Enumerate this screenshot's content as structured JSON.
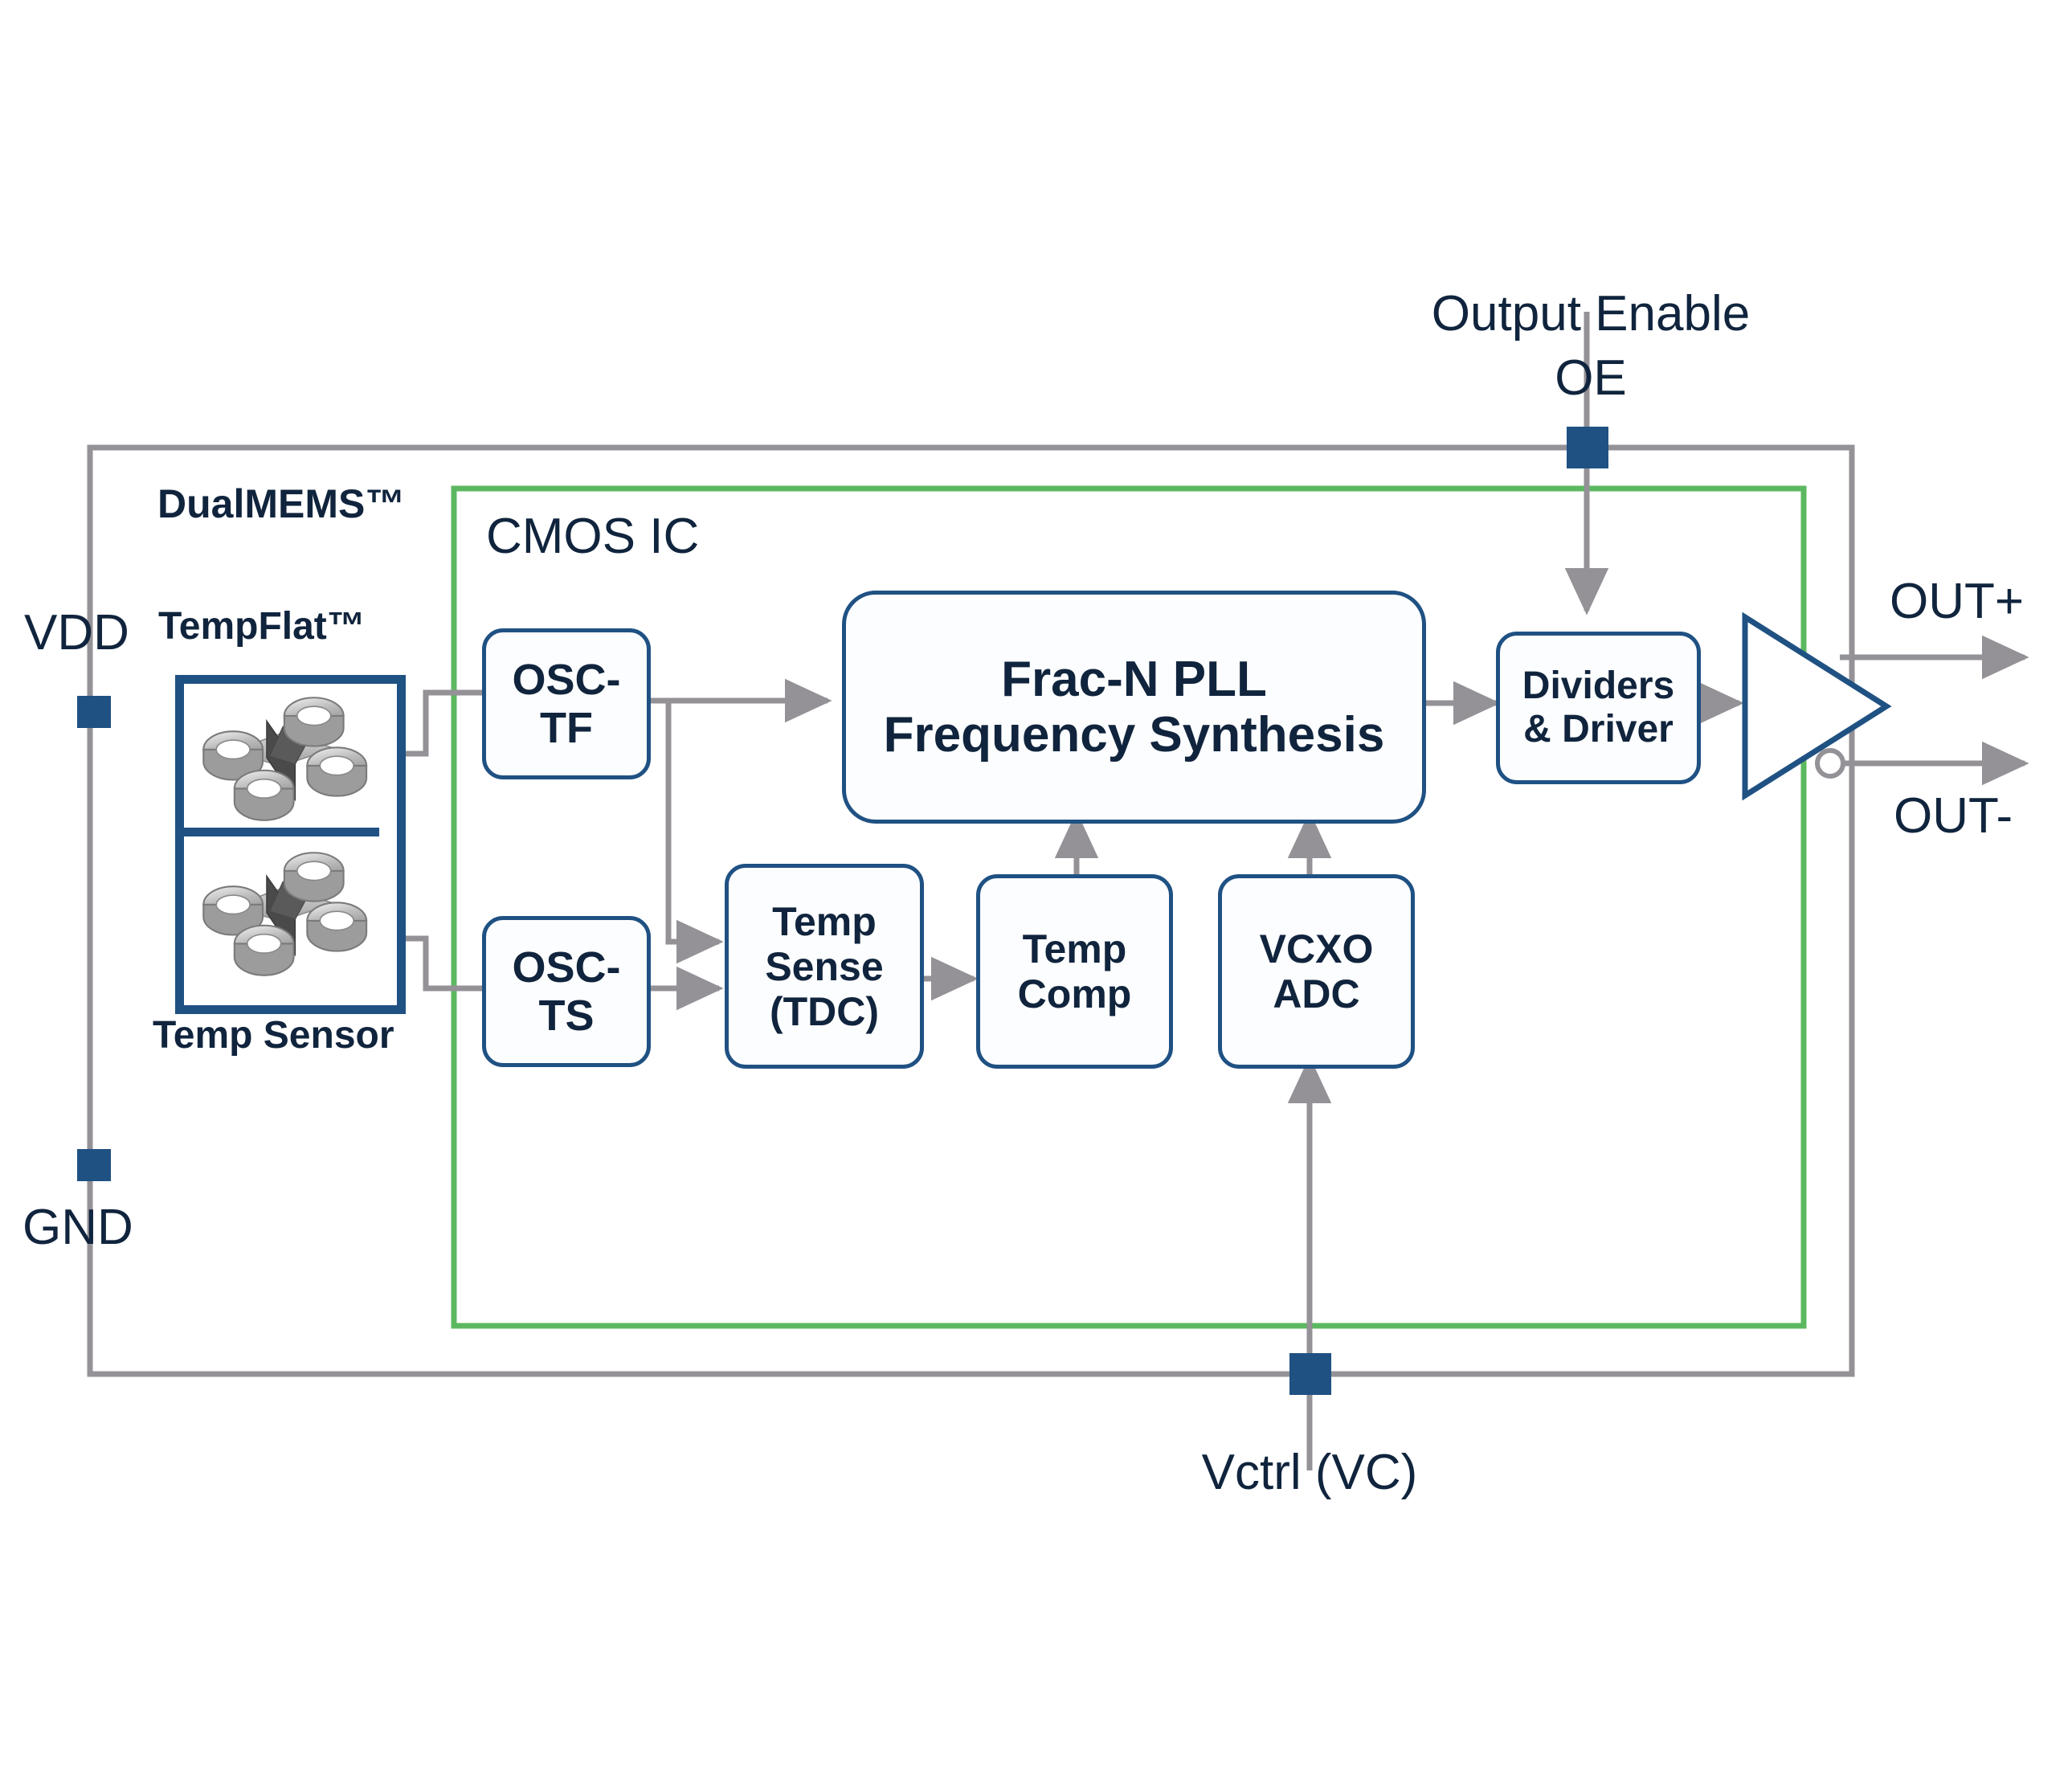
{
  "diagram": {
    "title": "MEMS Oscillator Functional Block Diagram",
    "colors": {
      "text_navy": "#10243d",
      "block_border_blue": "#1f5183",
      "ic_border_green": "#5cb860",
      "wire_gray": "#949197",
      "pin_blue": "#1f5183",
      "background": "#ffffff"
    }
  },
  "packages": {
    "outer_label": "DualMEMS™",
    "ic_label": "CMOS IC"
  },
  "mems": {
    "top_label": "TempFlat™",
    "bottom_label": "Temp Sensor",
    "resonator_icon_top": "mems-resonator-icon",
    "resonator_icon_bottom": "mems-resonator-icon"
  },
  "pins": [
    {
      "id": "vdd",
      "label": "VDD",
      "side": "left",
      "icon": "pin-square"
    },
    {
      "id": "gnd",
      "label": "GND",
      "side": "left",
      "icon": "pin-square"
    },
    {
      "id": "oe",
      "label": "Output Enable",
      "label2": "OE",
      "side": "top",
      "icon": "pin-square"
    },
    {
      "id": "vctrl",
      "label": "Vctrl (VC)",
      "side": "bottom",
      "icon": "pin-square"
    }
  ],
  "outputs": [
    {
      "id": "outp",
      "label": "OUT+",
      "polarity": "non-inverting"
    },
    {
      "id": "outn",
      "label": "OUT-",
      "polarity": "inverting"
    }
  ],
  "blocks": [
    {
      "id": "osc_tf",
      "label": "OSC-\nTF"
    },
    {
      "id": "osc_ts",
      "label": "OSC-\nTS"
    },
    {
      "id": "pll",
      "label": "Frac-N PLL\nFrequency Synthesis"
    },
    {
      "id": "temp_sense",
      "label": "Temp\nSense\n(TDC)"
    },
    {
      "id": "temp_comp",
      "label": "Temp\nComp"
    },
    {
      "id": "vcxo_adc",
      "label": "VCXO\nADC"
    },
    {
      "id": "dividers",
      "label": "Dividers\n& Driver"
    },
    {
      "id": "buffer",
      "label": "output-buffer-amplifier"
    }
  ],
  "block_labels": {
    "osc_tf_l1": "OSC-",
    "osc_tf_l2": "TF",
    "osc_ts_l1": "OSC-",
    "osc_ts_l2": "TS",
    "pll_l1": "Frac-N PLL",
    "pll_l2": "Frequency Synthesis",
    "temp_sense_l1": "Temp",
    "temp_sense_l2": "Sense",
    "temp_sense_l3": "(TDC)",
    "temp_comp_l1": "Temp",
    "temp_comp_l2": "Comp",
    "vcxo_adc_l1": "VCXO",
    "vcxo_adc_l2": "ADC",
    "dividers_l1": "Dividers",
    "dividers_l2": "& Driver"
  },
  "connections": [
    {
      "from": "mems_tempflat",
      "to": "osc_tf",
      "type": "signal"
    },
    {
      "from": "mems_tempsense",
      "to": "osc_ts",
      "type": "signal"
    },
    {
      "from": "osc_tf",
      "to": "pll",
      "type": "arrow"
    },
    {
      "from": "osc_tf",
      "to": "temp_sense",
      "type": "arrow"
    },
    {
      "from": "osc_ts",
      "to": "temp_sense",
      "type": "arrow"
    },
    {
      "from": "temp_sense",
      "to": "temp_comp",
      "type": "arrow"
    },
    {
      "from": "temp_comp",
      "to": "pll",
      "type": "arrow"
    },
    {
      "from": "vcxo_adc",
      "to": "pll",
      "type": "arrow"
    },
    {
      "from": "vctrl",
      "to": "vcxo_adc",
      "type": "arrow"
    },
    {
      "from": "pll",
      "to": "dividers",
      "type": "arrow"
    },
    {
      "from": "oe",
      "to": "dividers",
      "type": "arrow"
    },
    {
      "from": "dividers",
      "to": "buffer",
      "type": "arrow"
    },
    {
      "from": "buffer",
      "to": "outp",
      "type": "arrow"
    },
    {
      "from": "buffer",
      "to": "outn",
      "type": "arrow"
    }
  ]
}
